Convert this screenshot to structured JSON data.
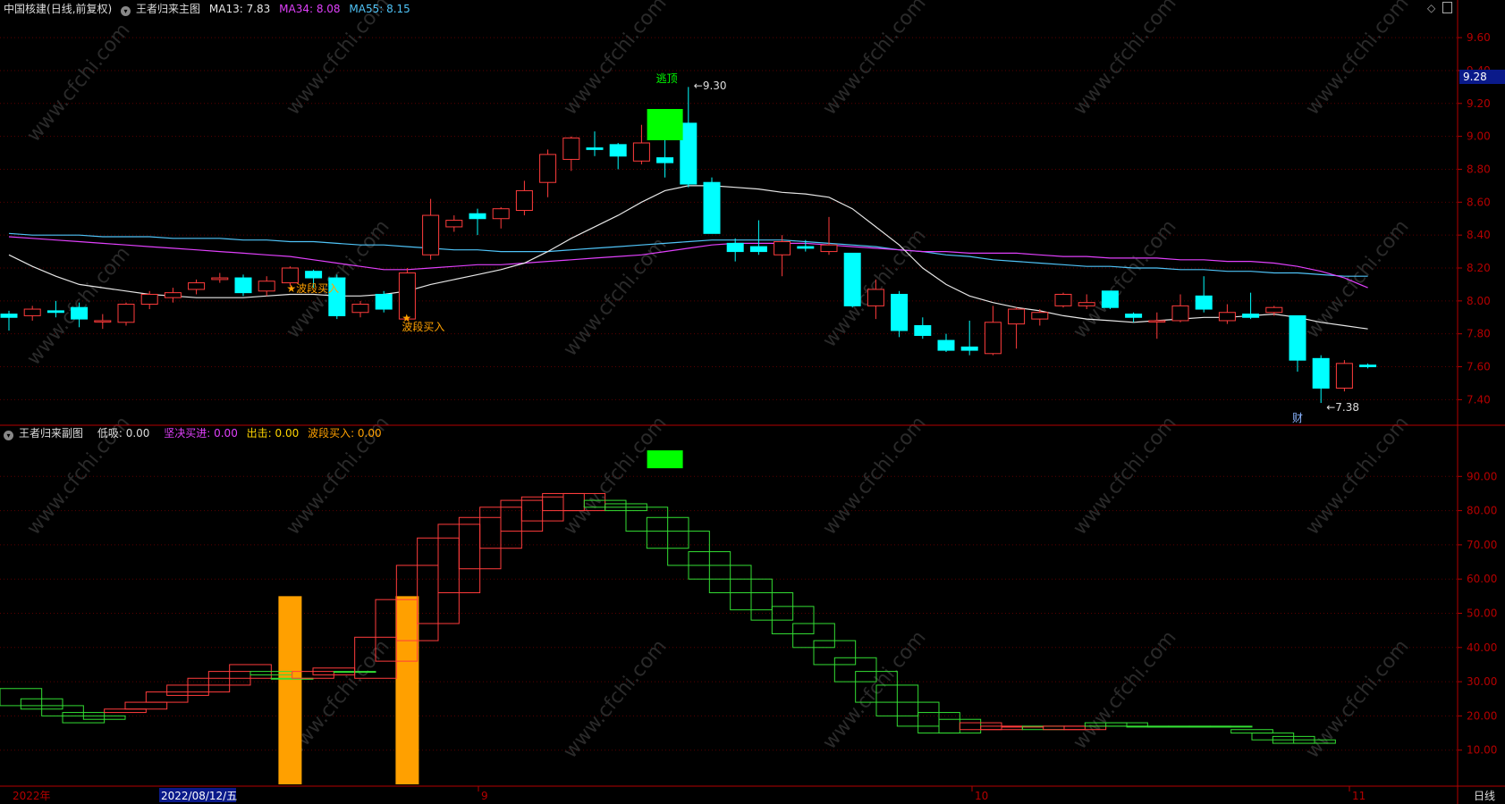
{
  "main_header": {
    "instrument": "中国核建",
    "period": "(日线,前复权)",
    "indicator": "王者归来主图",
    "ma13": "MA13: 7.83",
    "ma34": "MA34: 8.08",
    "ma55": "MA55: 8.15"
  },
  "sub_header": {
    "indicator": "王者归来副图",
    "dixi": "低吸: 0.00",
    "jianjue": "坚决买进: 0.00",
    "chuji": "出击: 0.00",
    "boduan": "波段买入: 0.00"
  },
  "current_price": "9.28",
  "footer": {
    "year_label": "2022年",
    "cursor_date": "2022/08/12/五",
    "month_9": "9",
    "month_10": "10",
    "month_11": "11",
    "period_button": "日线"
  },
  "annotations": {
    "top_label": "逃顶",
    "high_label": "9.30",
    "low_label": "7.38",
    "buy_label_1": "波段买入",
    "buy_label_2": "波段买入",
    "cai_label": "财"
  },
  "watermark": "www.cfchi.com",
  "colors": {
    "up": "#ff3c3c",
    "down": "#00ffff",
    "ma13": "#e6e6e6",
    "ma34": "#e040fb",
    "ma55": "#4fc3f7",
    "axis": "#b40000",
    "signal_green": "#00ff00",
    "signal_orange": "#ffa000",
    "box_down": "#33dd33"
  },
  "chart_data": [
    {
      "type": "candlestick",
      "title": "王者归来主图",
      "y_ticks": [
        7.4,
        7.6,
        7.8,
        8.0,
        8.2,
        8.4,
        8.6,
        8.8,
        9.0,
        9.2,
        9.4,
        9.6
      ],
      "ylim": [
        7.25,
        9.72
      ],
      "candles": [
        [
          7.92,
          7.9,
          7.94,
          7.82
        ],
        [
          7.91,
          7.95,
          7.97,
          7.88
        ],
        [
          7.94,
          7.93,
          8.0,
          7.9
        ],
        [
          7.96,
          7.89,
          7.99,
          7.84
        ],
        [
          7.88,
          7.88,
          7.92,
          7.83
        ],
        [
          7.87,
          7.98,
          7.99,
          7.85
        ],
        [
          7.98,
          8.04,
          8.06,
          7.95
        ],
        [
          8.02,
          8.05,
          8.08,
          7.99
        ],
        [
          8.07,
          8.11,
          8.13,
          8.04
        ],
        [
          8.13,
          8.14,
          8.17,
          8.11
        ],
        [
          8.14,
          8.05,
          8.16,
          8.03
        ],
        [
          8.06,
          8.12,
          8.15,
          8.03
        ],
        [
          8.11,
          8.2,
          8.21,
          8.09
        ],
        [
          8.18,
          8.14,
          8.19,
          8.08
        ],
        [
          8.14,
          7.91,
          8.16,
          7.89
        ],
        [
          7.93,
          7.98,
          8.0,
          7.9
        ],
        [
          8.04,
          7.95,
          8.06,
          7.93
        ],
        [
          7.89,
          8.17,
          8.2,
          7.88
        ],
        [
          8.28,
          8.52,
          8.62,
          8.25
        ],
        [
          8.45,
          8.49,
          8.52,
          8.42
        ],
        [
          8.53,
          8.5,
          8.56,
          8.4
        ],
        [
          8.5,
          8.56,
          8.57,
          8.44
        ],
        [
          8.55,
          8.67,
          8.73,
          8.52
        ],
        [
          8.72,
          8.89,
          8.92,
          8.63
        ],
        [
          8.86,
          8.99,
          9.0,
          8.79
        ],
        [
          8.93,
          8.92,
          9.03,
          8.88
        ],
        [
          8.95,
          8.88,
          8.96,
          8.8
        ],
        [
          8.85,
          8.96,
          9.07,
          8.83
        ],
        [
          8.87,
          8.84,
          9.04,
          8.75
        ],
        [
          9.08,
          8.71,
          9.3,
          8.69
        ],
        [
          8.72,
          8.41,
          8.75,
          8.65
        ],
        [
          8.35,
          8.3,
          8.38,
          8.24
        ],
        [
          8.33,
          8.3,
          8.49,
          8.28
        ],
        [
          8.28,
          8.36,
          8.4,
          8.15
        ],
        [
          8.33,
          8.32,
          8.37,
          8.3
        ],
        [
          8.3,
          8.34,
          8.51,
          8.28
        ],
        [
          8.29,
          7.97,
          8.29,
          7.96
        ],
        [
          7.97,
          8.07,
          8.13,
          7.89
        ],
        [
          8.04,
          7.82,
          8.06,
          7.78
        ],
        [
          7.85,
          7.79,
          7.9,
          7.77
        ],
        [
          7.76,
          7.7,
          7.8,
          7.69
        ],
        [
          7.72,
          7.7,
          7.88,
          7.67
        ],
        [
          7.68,
          7.87,
          7.97,
          7.67
        ],
        [
          7.86,
          7.95,
          7.96,
          7.71
        ],
        [
          7.89,
          7.93,
          7.95,
          7.85
        ],
        [
          7.97,
          8.04,
          8.05,
          7.96
        ],
        [
          7.97,
          7.99,
          8.04,
          7.95
        ],
        [
          8.06,
          7.96,
          8.06,
          7.95
        ],
        [
          7.92,
          7.9,
          7.93,
          7.87
        ],
        [
          7.88,
          7.88,
          7.93,
          7.77
        ],
        [
          7.88,
          7.97,
          8.04,
          7.87
        ],
        [
          8.03,
          7.95,
          8.15,
          7.93
        ],
        [
          7.88,
          7.93,
          7.98,
          7.86
        ],
        [
          7.92,
          7.9,
          8.05,
          7.89
        ],
        [
          7.93,
          7.96,
          7.97,
          7.91
        ],
        [
          7.91,
          7.64,
          7.91,
          7.57
        ],
        [
          7.65,
          7.47,
          7.67,
          7.38
        ],
        [
          7.47,
          7.62,
          7.64,
          7.45
        ],
        [
          7.61,
          7.6,
          7.62,
          7.59
        ]
      ],
      "ma13": [
        8.28,
        8.21,
        8.15,
        8.1,
        8.08,
        8.06,
        8.04,
        8.03,
        8.02,
        8.02,
        8.02,
        8.03,
        8.04,
        8.04,
        8.03,
        8.03,
        8.04,
        8.06,
        8.1,
        8.13,
        8.16,
        8.19,
        8.23,
        8.3,
        8.38,
        8.45,
        8.52,
        8.6,
        8.67,
        8.7,
        8.7,
        8.69,
        8.68,
        8.66,
        8.65,
        8.63,
        8.56,
        8.45,
        8.34,
        8.2,
        8.1,
        8.03,
        7.99,
        7.96,
        7.94,
        7.91,
        7.89,
        7.88,
        7.87,
        7.88,
        7.89,
        7.9,
        7.9,
        7.91,
        7.92,
        7.9,
        7.87,
        7.85,
        7.83
      ],
      "ma34": [
        8.39,
        8.38,
        8.37,
        8.36,
        8.35,
        8.34,
        8.33,
        8.32,
        8.31,
        8.3,
        8.29,
        8.28,
        8.27,
        8.25,
        8.23,
        8.21,
        8.19,
        8.19,
        8.2,
        8.21,
        8.22,
        8.22,
        8.23,
        8.24,
        8.25,
        8.26,
        8.27,
        8.28,
        8.3,
        8.32,
        8.34,
        8.35,
        8.35,
        8.35,
        8.35,
        8.34,
        8.33,
        8.32,
        8.31,
        8.3,
        8.3,
        8.29,
        8.29,
        8.29,
        8.28,
        8.27,
        8.27,
        8.26,
        8.26,
        8.26,
        8.25,
        8.25,
        8.24,
        8.24,
        8.23,
        8.21,
        8.18,
        8.14,
        8.08
      ],
      "ma55": [
        8.41,
        8.4,
        8.4,
        8.4,
        8.39,
        8.39,
        8.39,
        8.38,
        8.38,
        8.38,
        8.37,
        8.37,
        8.36,
        8.36,
        8.35,
        8.34,
        8.34,
        8.33,
        8.32,
        8.31,
        8.31,
        8.3,
        8.3,
        8.3,
        8.31,
        8.32,
        8.33,
        8.34,
        8.35,
        8.36,
        8.37,
        8.37,
        8.37,
        8.37,
        8.36,
        8.35,
        8.34,
        8.33,
        8.31,
        8.3,
        8.28,
        8.27,
        8.25,
        8.24,
        8.23,
        8.22,
        8.21,
        8.21,
        8.2,
        8.2,
        8.19,
        8.19,
        8.18,
        8.18,
        8.17,
        8.17,
        8.16,
        8.15,
        8.15
      ]
    },
    {
      "type": "box-oscillator",
      "title": "王者归来副图",
      "y_ticks": [
        10.0,
        20.0,
        30.0,
        40.0,
        50.0,
        60.0,
        70.0,
        80.0,
        90.0
      ],
      "ylim": [
        0,
        100
      ],
      "boxes": [
        [
          28,
          23
        ],
        [
          25,
          22
        ],
        [
          23,
          20
        ],
        [
          21,
          18
        ],
        [
          20,
          19
        ],
        [
          22,
          21
        ],
        [
          24,
          22
        ],
        [
          27,
          24
        ],
        [
          29,
          26
        ],
        [
          31,
          27
        ],
        [
          33,
          29
        ],
        [
          35,
          31
        ],
        [
          33,
          32
        ],
        [
          31,
          31
        ],
        [
          33,
          31
        ],
        [
          34,
          32
        ],
        [
          33,
          33
        ],
        [
          43,
          31
        ],
        [
          54,
          36
        ],
        [
          64,
          42
        ],
        [
          72,
          47
        ],
        [
          76,
          56
        ],
        [
          78,
          63
        ],
        [
          81,
          69
        ],
        [
          83,
          74
        ],
        [
          84,
          77
        ],
        [
          85,
          80
        ],
        [
          85,
          80
        ],
        [
          83,
          81
        ],
        [
          82,
          80
        ],
        [
          81,
          74
        ],
        [
          78,
          69
        ],
        [
          74,
          64
        ],
        [
          68,
          60
        ],
        [
          64,
          56
        ],
        [
          60,
          51
        ],
        [
          56,
          48
        ],
        [
          52,
          44
        ],
        [
          47,
          40
        ],
        [
          42,
          35
        ],
        [
          37,
          30
        ],
        [
          33,
          24
        ],
        [
          29,
          20
        ],
        [
          24,
          17
        ],
        [
          21,
          15
        ],
        [
          19,
          15
        ],
        [
          18,
          16
        ],
        [
          17,
          16
        ],
        [
          17,
          17
        ],
        [
          17,
          16
        ],
        [
          17,
          16
        ],
        [
          17,
          16
        ],
        [
          18,
          17
        ],
        [
          18,
          17
        ],
        [
          17,
          17
        ],
        [
          17,
          17
        ],
        [
          17,
          17
        ],
        [
          17,
          17
        ],
        [
          17,
          17
        ],
        [
          16,
          15
        ],
        [
          15,
          13
        ],
        [
          14,
          12
        ],
        [
          13,
          12
        ]
      ],
      "box_direction": [
        "d",
        "d",
        "d",
        "d",
        "d",
        "u",
        "u",
        "u",
        "u",
        "u",
        "u",
        "u",
        "d",
        "d",
        "u",
        "u",
        "d",
        "u",
        "u",
        "u",
        "u",
        "u",
        "u",
        "u",
        "u",
        "u",
        "u",
        "u",
        "d",
        "d",
        "d",
        "d",
        "d",
        "d",
        "d",
        "d",
        "d",
        "d",
        "d",
        "d",
        "d",
        "d",
        "d",
        "d",
        "d",
        "d",
        "u",
        "u",
        "u",
        "d",
        "u",
        "u",
        "d",
        "d",
        "d",
        "d",
        "d",
        "d",
        "d",
        "d",
        "d",
        "d",
        "d"
      ],
      "orange_bars": [
        {
          "index": 12,
          "value": 55
        },
        {
          "index": 17,
          "value": 55
        }
      ],
      "green_marker": {
        "index": 28,
        "value": 95
      }
    }
  ]
}
